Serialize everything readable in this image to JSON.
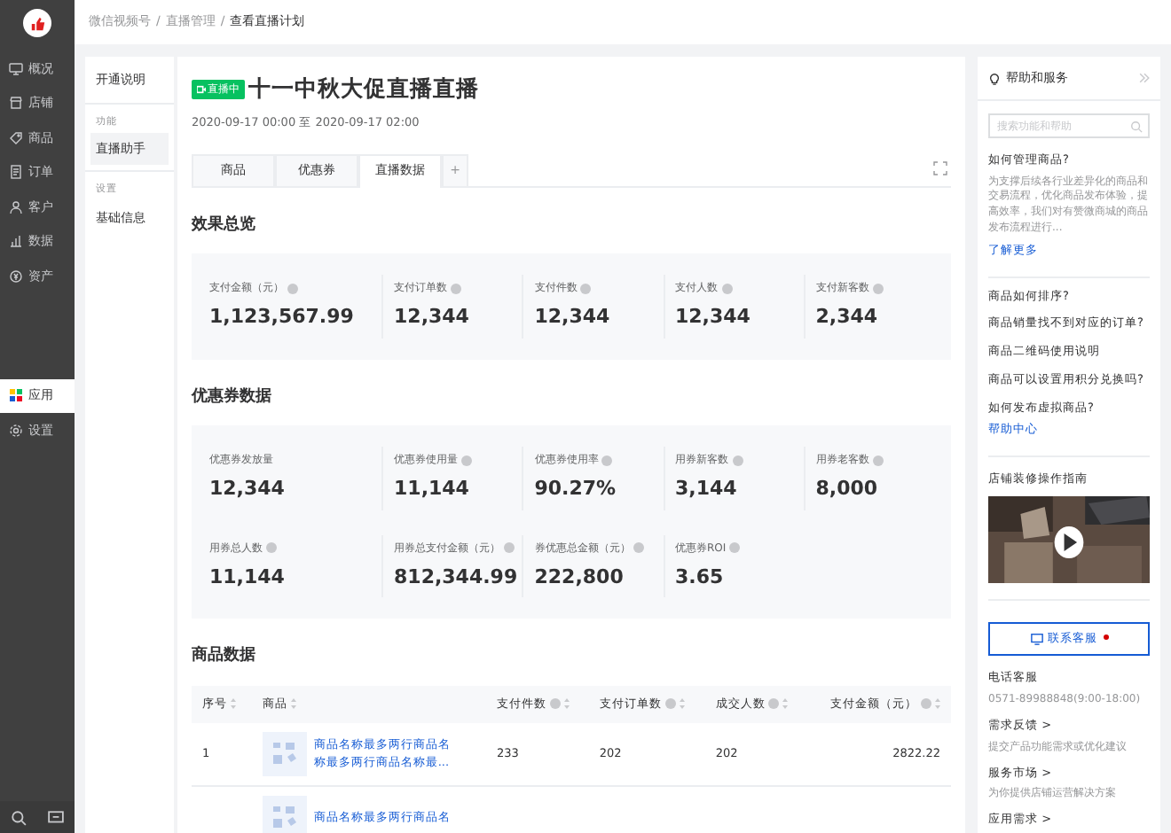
{
  "sidebar": {
    "groups": [
      [
        {
          "label": "概况",
          "kind": "monitor",
          "selected": false
        },
        {
          "label": "店铺",
          "kind": "store",
          "selected": false
        },
        {
          "label": "商品",
          "kind": "tag",
          "selected": false
        },
        {
          "label": "订单",
          "kind": "list",
          "selected": false
        },
        {
          "label": "客户",
          "kind": "user",
          "selected": false
        },
        {
          "label": "数据",
          "kind": "chart",
          "selected": false
        },
        {
          "label": "资产",
          "kind": "coin",
          "selected": false
        }
      ],
      [
        {
          "label": "应用",
          "kind": "apps",
          "selected": true
        },
        {
          "label": "设置",
          "kind": "gear",
          "selected": false
        }
      ]
    ]
  },
  "breadcrumb": {
    "separator": "/",
    "items": [
      "微信视频号",
      "直播管理",
      "查看直播计划"
    ]
  },
  "subnav": [
    {
      "kind": "item",
      "label": "开通说明",
      "selected": false
    },
    {
      "kind": "group",
      "label": "功能"
    },
    {
      "kind": "item",
      "label": "直播助手",
      "selected": true
    },
    {
      "kind": "group",
      "label": "设置"
    },
    {
      "kind": "item",
      "label": "基础信息",
      "selected": false
    }
  ],
  "plan": {
    "status": "直播中",
    "title": "十一中秋大促直播直播",
    "time": "2020-09-17 00:00 至 2020-09-17 02:00"
  },
  "tabs": [
    {
      "label": "商品",
      "selected": false
    },
    {
      "label": "优惠券",
      "selected": false
    },
    {
      "label": "直播数据",
      "selected": true
    },
    {
      "label": "+",
      "selected": false
    }
  ],
  "sections": [
    {
      "title": "效果总览",
      "rows": [
        [
          {
            "label": "支付金额（元）",
            "value": "1,123,567.99",
            "info": true
          },
          {
            "label": "支付订单数",
            "value": "12,344",
            "info": true
          },
          {
            "label": "支付件数",
            "value": "12,344",
            "info": true
          },
          {
            "label": "支付人数",
            "value": "12,344",
            "info": true
          },
          {
            "label": "支付新客数",
            "value": "2,344",
            "info": true
          }
        ]
      ]
    },
    {
      "title": "优惠券数据",
      "rows": [
        [
          {
            "label": "优惠券发放量",
            "value": "12,344",
            "info": false
          },
          {
            "label": "优惠券使用量",
            "value": "11,144",
            "info": true
          },
          {
            "label": "优惠券使用率",
            "value": "90.27%",
            "info": true
          },
          {
            "label": "用券新客数",
            "value": "3,144",
            "info": true
          },
          {
            "label": "用券老客数",
            "value": "8,000",
            "info": true
          }
        ],
        [
          {
            "label": "用券总人数",
            "value": "11,144",
            "info": true
          },
          {
            "label": "用券总支付金额（元）",
            "value": "812,344.99",
            "info": true
          },
          {
            "label": "券优惠总金额（元）",
            "value": "222,800",
            "info": true
          },
          {
            "label": "优惠券ROI",
            "value": "3.65",
            "info": true
          }
        ]
      ]
    }
  ],
  "products": {
    "title": "商品数据",
    "columns": [
      {
        "label": "序号",
        "info": false
      },
      {
        "label": "商品",
        "info": false
      },
      {
        "label": "支付件数",
        "info": true
      },
      {
        "label": "支付订单数",
        "info": true
      },
      {
        "label": "成交人数",
        "info": true
      },
      {
        "label": "支付金额（元）",
        "info": true
      }
    ],
    "rows": [
      {
        "cells": [
          "1",
          "商品名称最多两行商品名称最多两行商品名称最...",
          "233",
          "202",
          "202",
          "2822.22"
        ]
      },
      {
        "cells": [
          "",
          "商品名称最多两行商品名",
          "",
          "",
          "",
          ""
        ]
      }
    ]
  },
  "help": {
    "title": "帮助和服务",
    "search": {
      "placeholder": "搜索功能和帮助"
    },
    "article": {
      "title": "如何管理商品?",
      "text": "为支撑后续各行业差异化的商品和交易流程，优化商品发布体验，提高效率，我们对有赞微商城的商品发布流程进行...",
      "link": "了解更多"
    },
    "questions": [
      "商品如何排序?",
      "商品销量找不到对应的订单?",
      "商品二维码使用说明",
      "商品可以设置用积分兑换吗?",
      "如何发布虚拟商品?"
    ],
    "center_link": "帮助中心",
    "video_title": "店铺装修操作指南",
    "contact": "联系客服",
    "phone": {
      "title": "电话客服",
      "text": "0571-89988848(9:00-18:00)"
    },
    "services": [
      {
        "title": "需求反馈 >",
        "text": "提交产品功能需求或优化建议"
      },
      {
        "title": "服务市场 >",
        "text": "为你提供店铺运营解决方案"
      },
      {
        "title": "应用需求 >"
      }
    ]
  }
}
